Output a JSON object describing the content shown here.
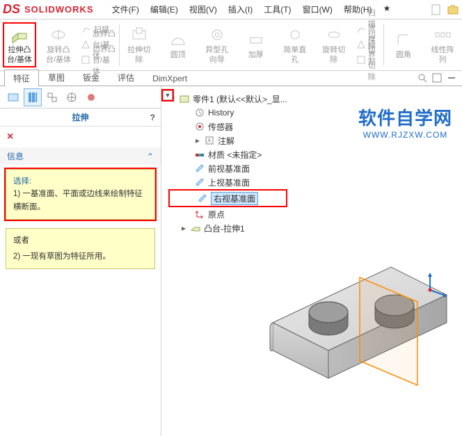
{
  "app": {
    "logo_ds": "DS",
    "logo_sw": "SOLIDWORKS"
  },
  "menu": {
    "file": "文件(F)",
    "edit": "编辑(E)",
    "view": "视图(V)",
    "insert": "插入(I)",
    "tools": "工具(T)",
    "window": "窗口(W)",
    "help": "帮助(H)",
    "search": "★"
  },
  "ribbon": {
    "extrude_boss": "拉伸凸\n台/基体",
    "revolve_boss": "旋转凸\n台/基体",
    "sweep": "扫描",
    "loft_boss": "放样凸台/基体",
    "boundary_boss": "边界凸台/基体",
    "extrude_cut": "拉伸切\n除",
    "hole_wiz": "异型孔\n向导",
    "revolve_cut": "旋转切\n除",
    "swept_cut": "扫描切除",
    "loft_cut": "放样切割",
    "boundary_cut": "边界切除",
    "fillet": "圆角",
    "linear_pat": "线性阵\n列",
    "simple_hole": "简单直\n孔",
    "thicken": "加厚",
    "dome": "圆顶"
  },
  "tabs": {
    "feature": "特征",
    "sketch": "草图",
    "sheet": "钣金",
    "eval": "评估",
    "dimx": "DimXpert"
  },
  "pm": {
    "title": "拉伸",
    "help": "?",
    "close": "×",
    "info_header": "信息",
    "select_label": "选择:",
    "select_text": "1) 一基准面、平面或边线来绘制特征横断面。",
    "or": "或者",
    "use_text": "2) 一现有草图为特征所用。"
  },
  "tree": {
    "root": "零件1  (默认<<默认>_显...",
    "history": "History",
    "sensors": "传感器",
    "notes": "注解",
    "material": "材质 <未指定>",
    "front": "前视基准面",
    "top": "上视基准面",
    "right": "右视基准面",
    "origin": "原点",
    "feat1": "凸台-拉伸1"
  },
  "watermark": {
    "cn": "软件自学网",
    "en": "WWW.RJZXW.COM"
  }
}
